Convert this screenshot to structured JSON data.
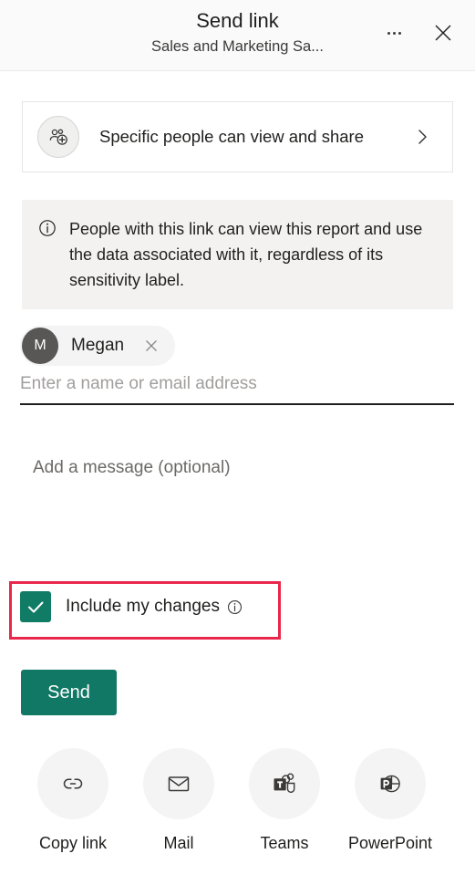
{
  "header": {
    "title": "Send link",
    "subtitle": "Sales and Marketing Sa...",
    "more_icon": "more-horizontal-icon",
    "close_icon": "close-icon"
  },
  "permission": {
    "icon": "people-add-icon",
    "label": "Specific people can view and share",
    "chevron_icon": "chevron-right-icon"
  },
  "info_banner": {
    "icon": "info-circle-icon",
    "text": "People with this link can view this report and use the data associated with it, regardless of its sensitivity label."
  },
  "recipients": [
    {
      "initial": "M",
      "name": "Megan",
      "remove_icon": "close-icon"
    }
  ],
  "name_field": {
    "value": "",
    "placeholder": "Enter a name or email address"
  },
  "message_field": {
    "value": "",
    "placeholder": "Add a message (optional)"
  },
  "include_changes": {
    "label": "Include my changes",
    "checked": true,
    "check_icon": "checkmark-icon",
    "info_icon": "info-circle-icon",
    "checkbox_color": "#107c66"
  },
  "highlight": {
    "color": "#e8274b"
  },
  "send_button": {
    "label": "Send",
    "color": "#117865"
  },
  "share_targets": [
    {
      "label": "Copy link",
      "icon": "link-icon"
    },
    {
      "label": "Mail",
      "icon": "mail-icon"
    },
    {
      "label": "Teams",
      "icon": "teams-icon"
    },
    {
      "label": "PowerPoint",
      "icon": "powerpoint-icon"
    }
  ]
}
